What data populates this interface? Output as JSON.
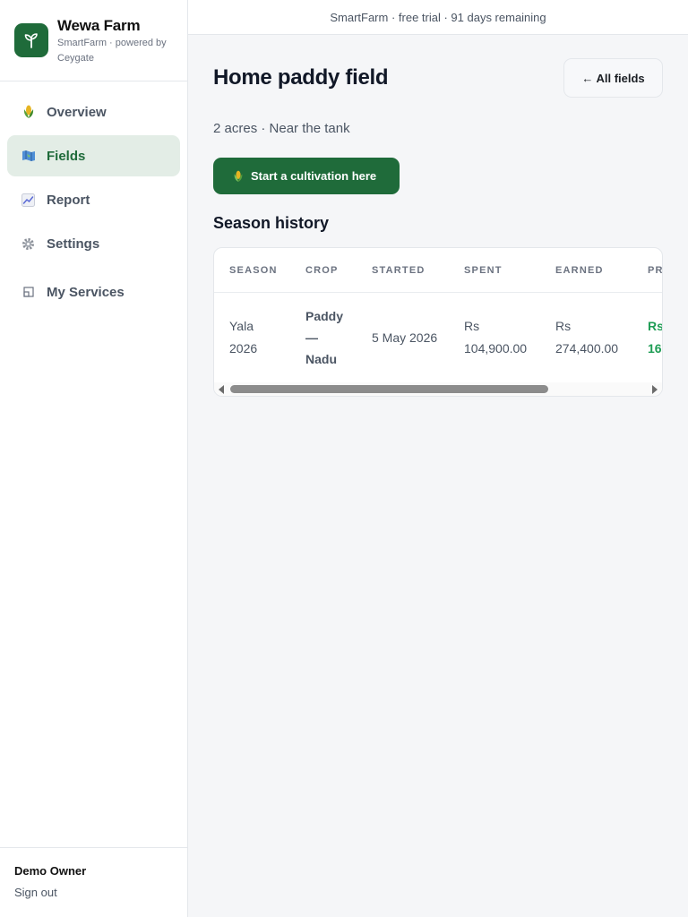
{
  "topbar": {
    "trial_text": "SmartFarm · free trial · 91 days remaining"
  },
  "brand": {
    "name": "Wewa Farm",
    "subtitle": "SmartFarm · powered by Ceygate",
    "logo_icon": "seedling-icon",
    "color": "#1f6b3a"
  },
  "sidebar": {
    "items": [
      {
        "label": "Overview",
        "icon": "corn-icon",
        "active": false
      },
      {
        "label": "Fields",
        "icon": "map-icon",
        "active": true
      },
      {
        "label": "Report",
        "icon": "chart-icon",
        "active": false
      },
      {
        "label": "Settings",
        "icon": "gear-icon",
        "active": false
      },
      {
        "label": "My Services",
        "icon": "window-icon",
        "active": false
      }
    ],
    "owner_name": "Demo Owner",
    "signout_label": "Sign out"
  },
  "page": {
    "title": "Home paddy field",
    "back_label": "← All fields",
    "meta": "2 acres · Near the tank",
    "start_button_label": "Start a cultivation here",
    "start_button_icon": "corn-icon",
    "section_title": "Season history"
  },
  "table": {
    "columns": [
      "SEASON",
      "CROP",
      "STARTED",
      "SPENT",
      "EARNED",
      "PR"
    ],
    "rows": [
      {
        "season_l1": "Yala",
        "season_l2": "2026",
        "crop_l1": "Paddy",
        "crop_l2": "—",
        "crop_l3": "Nadu",
        "started": "5 May 2026",
        "spent_l1": "Rs",
        "spent_l2": "104,900.00",
        "earned_l1": "Rs",
        "earned_l2": "274,400.00",
        "profit_l1": "Rs",
        "profit_l2": "16"
      }
    ]
  },
  "colors": {
    "accent": "#1f6b3a",
    "active_bg": "#e3ede6",
    "profit": "#1f9d55"
  }
}
